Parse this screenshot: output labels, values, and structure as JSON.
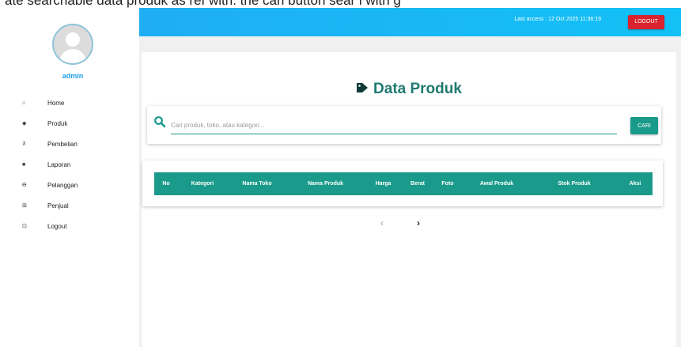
{
  "caption": "ate searchable data produk as ref with. the cari button sear l with g",
  "sidebar": {
    "username": "admin",
    "items": [
      {
        "icon": "home-icon",
        "glyph": "⌂",
        "label": "Home"
      },
      {
        "icon": "tag-icon",
        "glyph": "◆",
        "label": "Produk"
      },
      {
        "icon": "cart-icon",
        "glyph": "⊼",
        "label": "Pembelian"
      },
      {
        "icon": "file-icon",
        "glyph": "■",
        "label": "Laporan"
      },
      {
        "icon": "account-circle-icon",
        "glyph": "ϴ",
        "label": "Pelanggan"
      },
      {
        "icon": "store-icon",
        "glyph": "⊞",
        "label": "Penjual"
      },
      {
        "icon": "logout-icon",
        "glyph": "⊡",
        "label": "Logout"
      }
    ]
  },
  "topbar": {
    "last_access": "Last access : 12 Oct 2025 11:36:19",
    "logout_label": "LOGOUT",
    "gradient_start": "#1faef3",
    "gradient_end": "#13c1f6",
    "logout_color": "#d9232e"
  },
  "main": {
    "title": "Data Produk",
    "search": {
      "placeholder": "Cari produk, toko, atau kategori...",
      "value": "",
      "button_label": "CARI"
    },
    "table": {
      "columns": [
        "No",
        "Kategori",
        "Nama Toko",
        "Nama Produk",
        "Harga",
        "Berat",
        "Foto",
        "Awal Produk",
        "Stok Produk",
        "Aksi"
      ],
      "rows": []
    },
    "pager": {
      "prev": "‹",
      "next": "›"
    },
    "accent_color": "#1a9a8a"
  }
}
